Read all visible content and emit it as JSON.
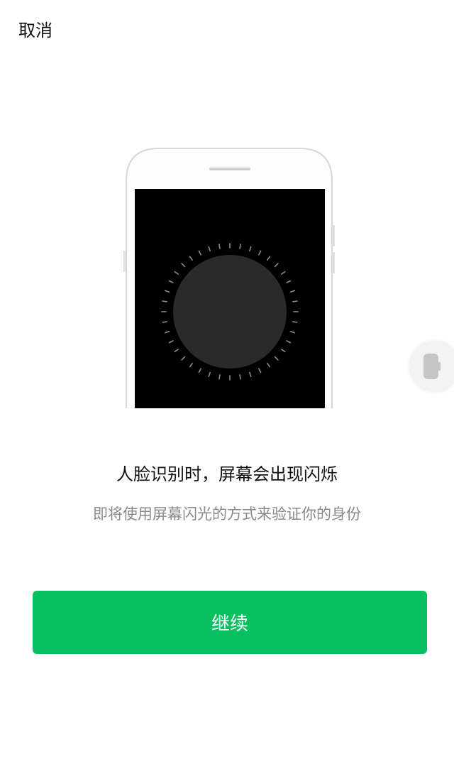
{
  "header": {
    "cancel_label": "取消"
  },
  "main": {
    "title": "人脸识别时，屏幕会出现闪烁",
    "subtitle": "即将使用屏幕闪光的方式来验证你的身份"
  },
  "actions": {
    "continue_label": "继续"
  },
  "colors": {
    "accent": "#07c160",
    "subtitle_text": "#8a8a8a",
    "phone_screen": "#000000",
    "scan_circle": "#2a2a2a"
  },
  "icons": {
    "illustration": "phone-with-face-scan-circle-icon",
    "floating_handle": "floating-window-handle-icon"
  }
}
